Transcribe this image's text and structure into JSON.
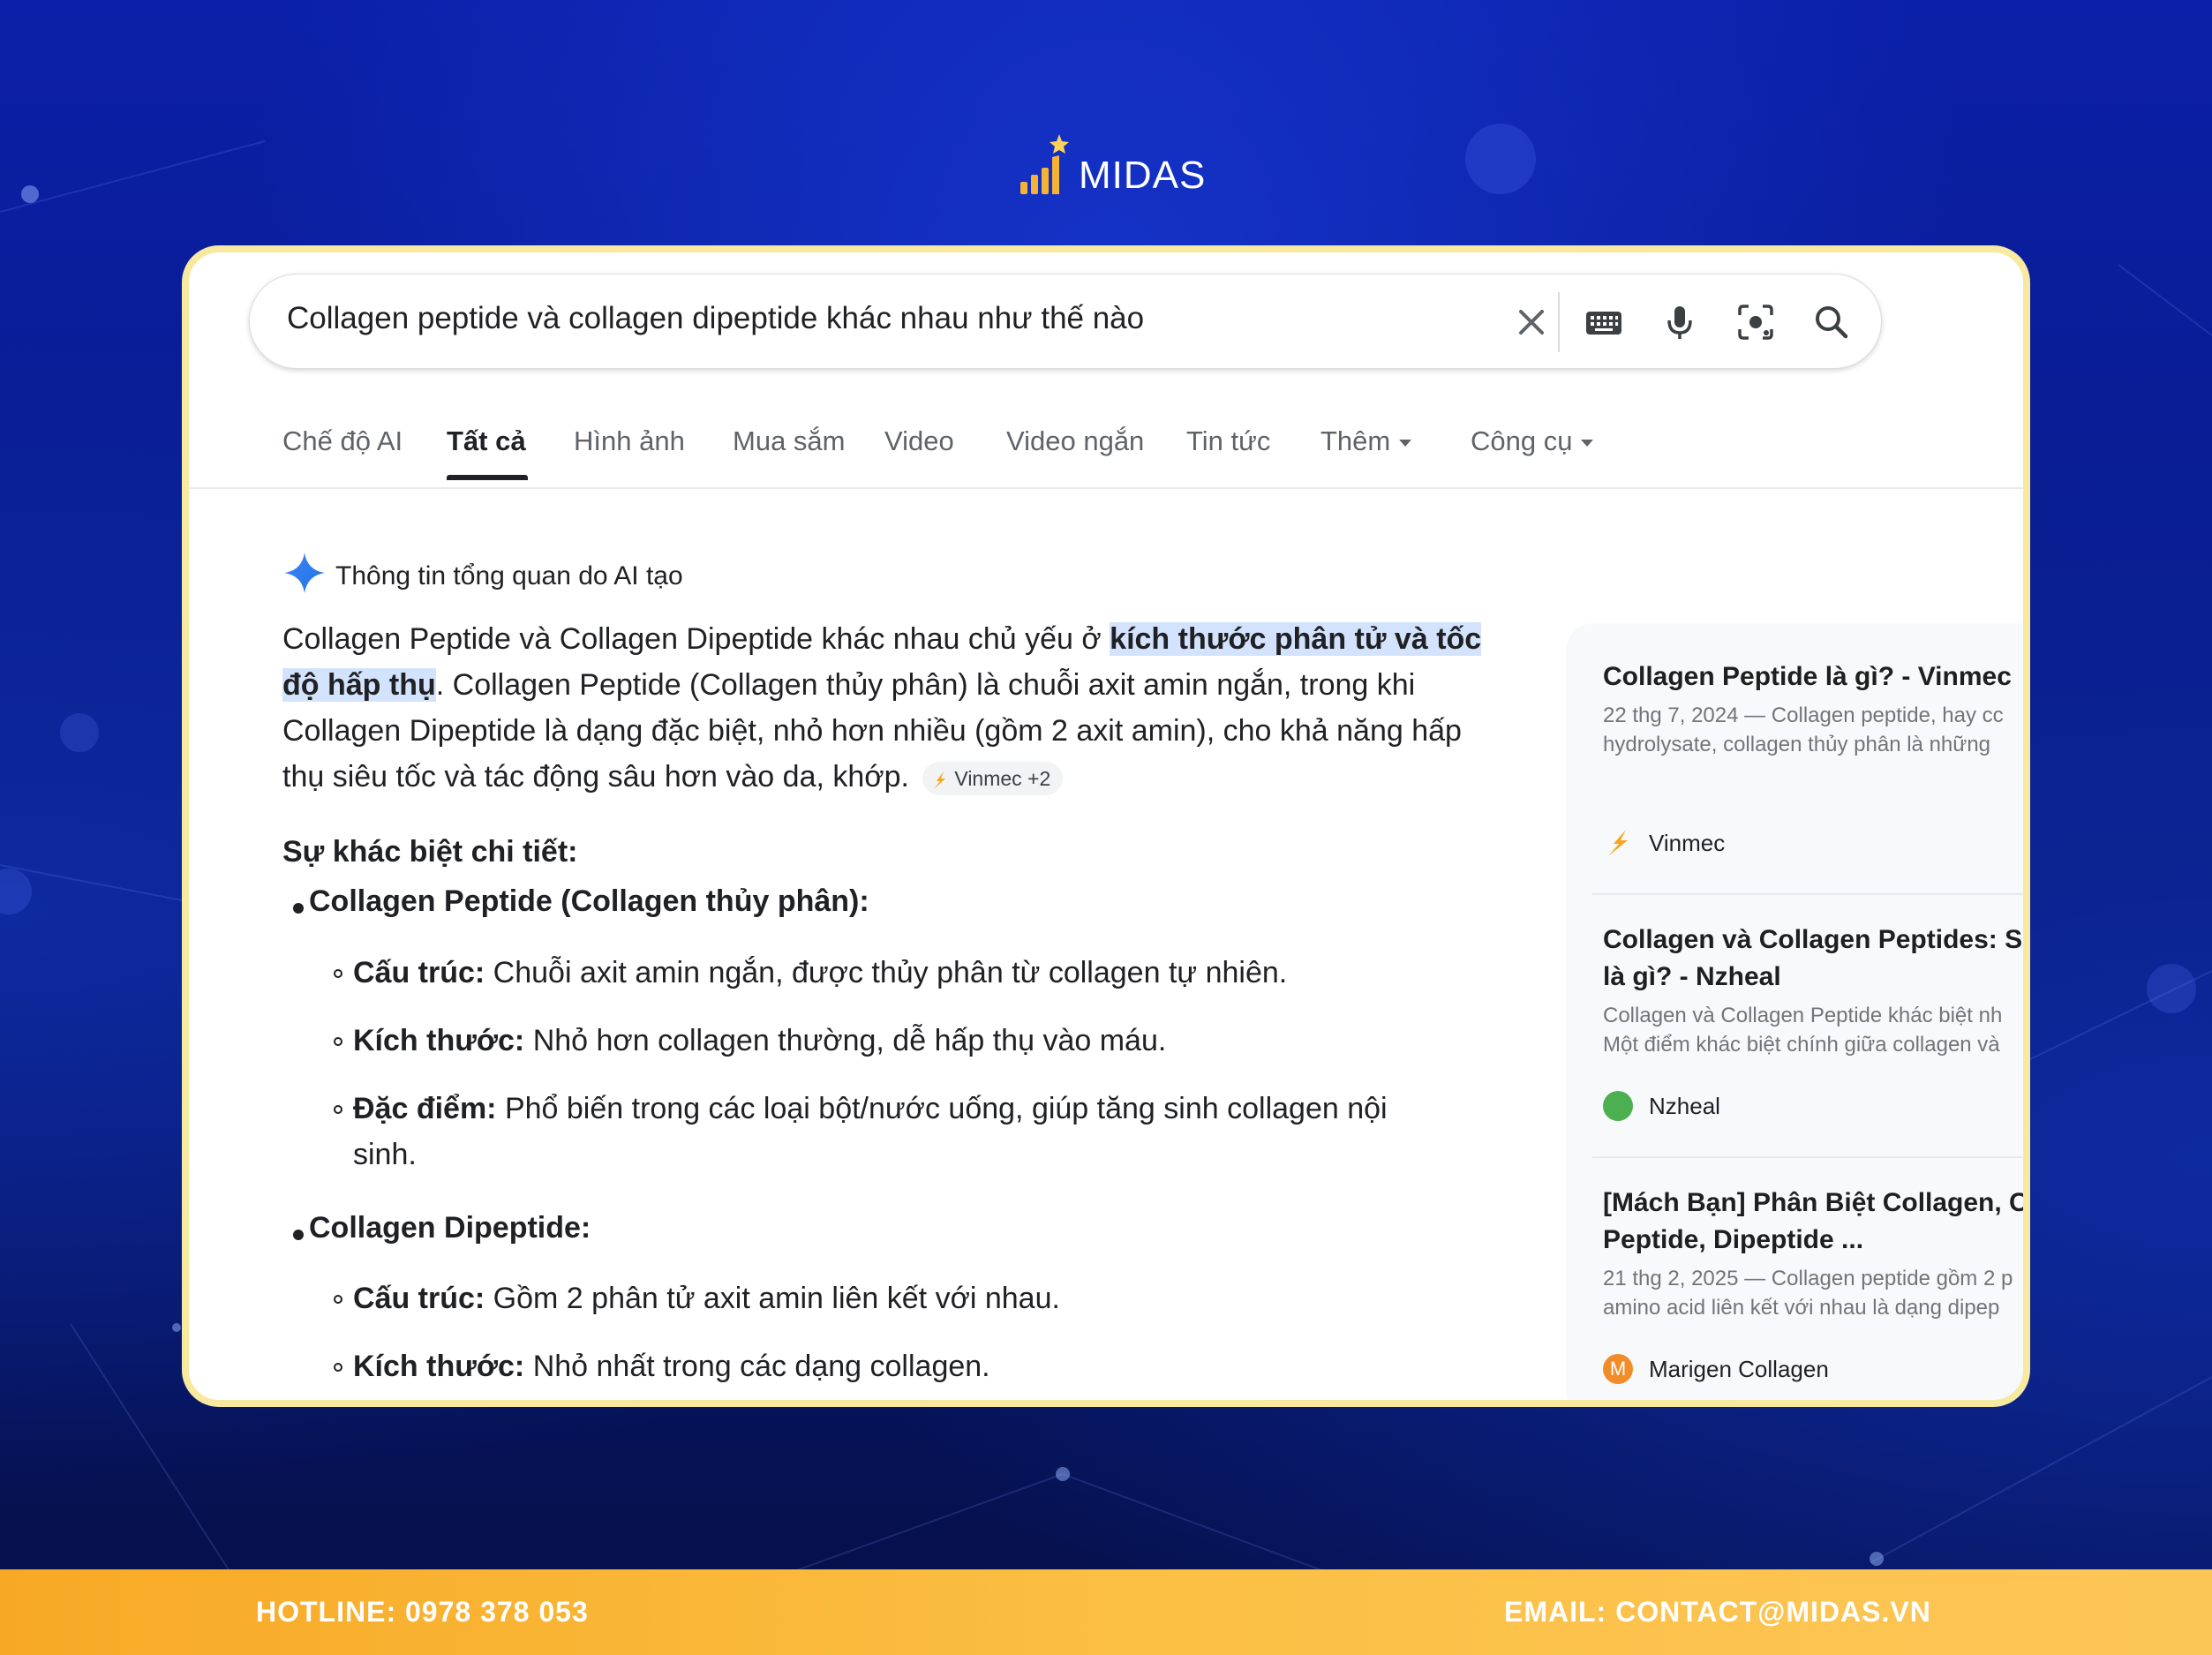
{
  "brand": {
    "name": "MIDAS"
  },
  "search": {
    "query": "Collagen peptide và collagen dipeptide khác nhau như thế nào",
    "icons": [
      "close-icon",
      "keyboard-icon",
      "mic-icon",
      "lens-icon",
      "search-icon"
    ]
  },
  "tabs": [
    {
      "label": "Chế độ AI",
      "active": false
    },
    {
      "label": "Tất cả",
      "active": true
    },
    {
      "label": "Hình ảnh",
      "active": false
    },
    {
      "label": "Mua sắm",
      "active": false
    },
    {
      "label": "Video",
      "active": false
    },
    {
      "label": "Video ngắn",
      "active": false
    },
    {
      "label": "Tin tức",
      "active": false
    },
    {
      "label": "Thêm",
      "active": false,
      "dropdown": true
    },
    {
      "label": "Công cụ",
      "active": false,
      "dropdown": true
    }
  ],
  "ai_overview": {
    "heading": "Thông tin tổng quan do AI tạo",
    "intro_before": "Collagen Peptide và Collagen Dipeptide khác nhau chủ yếu ở ",
    "intro_highlight": "kích thước phân tử và tốc độ hấp thụ",
    "intro_after": ". Collagen Peptide (Collagen thủy phân) là chuỗi axit amin ngắn, trong khi Collagen Dipeptide là dạng đặc biệt, nhỏ hơn nhiều (gồm 2 axit amin), cho khả năng hấp thụ siêu tốc và tác động sâu hơn vào da, khớp.",
    "source_chip": "Vinmec +2",
    "subheading": "Sự khác biệt chi tiết:",
    "sections": [
      {
        "title": "Collagen Peptide (Collagen thủy phân):",
        "items": [
          {
            "label": "Cấu trúc:",
            "text": " Chuỗi axit amin ngắn, được thủy phân từ collagen tự nhiên."
          },
          {
            "label": "Kích thước:",
            "text": " Nhỏ hơn collagen thường, dễ hấp thụ vào máu."
          },
          {
            "label": "Đặc điểm:",
            "text": " Phổ biến trong các loại bột/nước uống, giúp tăng sinh collagen nội sinh."
          }
        ]
      },
      {
        "title": "Collagen Dipeptide:",
        "items": [
          {
            "label": "Cấu trúc:",
            "text": " Gồm 2 phân tử axit amin liên kết với nhau."
          },
          {
            "label": "Kích thước:",
            "text": " Nhỏ nhất trong các dạng collagen."
          }
        ]
      }
    ]
  },
  "sources": [
    {
      "title": "Collagen Peptide là gì? - Vinmec",
      "snippet": [
        "22 thg 7, 2024 — Collagen peptide, hay cc",
        "hydrolysate, collagen thủy phân là những"
      ],
      "site": "Vinmec",
      "icon_color": "#f5a623"
    },
    {
      "title": "Collagen và Collagen Peptides: Sự",
      "title2": "là gì? - Nzheal",
      "snippet": [
        "Collagen và Collagen Peptide khác biệt nh",
        "Một điểm khác biệt chính giữa collagen và"
      ],
      "site": "Nzheal",
      "icon_color": "#4caf50"
    },
    {
      "title": "[Mách Bạn] Phân Biệt Collagen, Co",
      "title2": "Peptide, Dipeptide ...",
      "snippet": [
        "21 thg 2, 2025 — Collagen peptide gồm 2 p",
        "amino acid liên kết với nhau là dạng dipep"
      ],
      "site": "Marigen Collagen",
      "icon_color": "#f28c28",
      "icon_letter": "M"
    }
  ],
  "footer": {
    "hotline": "HOTLINE: 0978 378 053",
    "email": "EMAIL: CONTACT@MIDAS.VN"
  }
}
